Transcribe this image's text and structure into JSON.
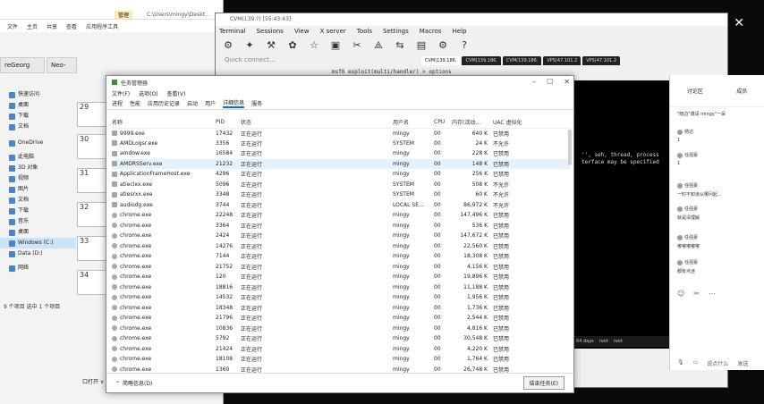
{
  "explorer": {
    "ribbon_tab": "管理",
    "path": "C:\\Users\\mingy\\Deskt...",
    "ribbon": [
      "文件",
      "主页",
      "共享",
      "查看",
      "应用程序工具"
    ],
    "tab1": "reGeorg",
    "tab2": "Neo-",
    "tree": [
      "快速访问",
      "桌面",
      "下载",
      "文档",
      "OneDrive",
      "此电脑",
      "3D 对象",
      "视频",
      "图片",
      "文档",
      "下载",
      "音乐",
      "桌面",
      "Windows (C:)",
      "Data (D:)",
      "网络"
    ],
    "status": "9 个项目  选中 1 个项目",
    "thumb_numbers": [
      "29",
      "30",
      "31",
      "32",
      "33",
      "34"
    ],
    "thumb_footer": "口打开 ∨"
  },
  "moba": {
    "title": "CVM(139.?)  [55:43:43]",
    "menu": [
      "Terminal",
      "Sessions",
      "View",
      "X server",
      "Tools",
      "Settings",
      "Macros",
      "Help"
    ],
    "toolbar": [
      "Session",
      "Servers",
      "Tools",
      "Games",
      "Sessions",
      "View",
      "Split",
      "MultiExec",
      "Tunneling",
      "Packages",
      "Settings",
      "Help"
    ],
    "quick_connect": "Quick connect...",
    "tabs": [
      "CVM(139.186.",
      "CVM(139.186.",
      "CVM(139.186.",
      "VPS(47.101.2",
      "VPS(47.101.2"
    ],
    "cmd": "msf6 exploit(multi/handler) > options",
    "term_lines": [
      "'', seh, thread, process",
      "terface may be specified"
    ],
    "status_items": [
      "64 days",
      "root",
      "root"
    ]
  },
  "chat": {
    "tabs": [
      "讨论区",
      "成员"
    ],
    "messages": [
      "\"暗边\"邀请 mingy\"一朵",
      "杨达",
      "1",
      "任强豪",
      "1",
      "任强豪",
      "一时不知道从哪问起..",
      "任强豪",
      "就是没理解",
      "任强豪",
      "嘟嘟嘟嘟嘟",
      "任强豪",
      "都有点迷"
    ],
    "input_hint": "说点什么",
    "send": "发送"
  },
  "taskmgr": {
    "title": "任务管理器",
    "menu": [
      "文件(F)",
      "选项(O)",
      "查看(V)"
    ],
    "tabs": [
      "进程",
      "性能",
      "应用历史记录",
      "启动",
      "用户",
      "详细信息",
      "服务"
    ],
    "active_tab": "详细信息",
    "columns": [
      "名称",
      "PID",
      "状态",
      "用户名",
      "CPU",
      "内存(活动...",
      "UAC 虚拟化"
    ],
    "rows": [
      [
        "9999.exe",
        "17432",
        "正在运行",
        "mingy",
        "00",
        "640 K",
        "已禁用"
      ],
      [
        "AMDLogsr.exe",
        "3356",
        "正在运行",
        "SYSTEM",
        "00",
        "24 K",
        "不允许"
      ],
      [
        "amdow.exe",
        "16584",
        "正在运行",
        "mingy",
        "00",
        "228 K",
        "已禁用"
      ],
      [
        "AMDRSServ.exe",
        "21232",
        "正在运行",
        "mingy",
        "00",
        "148 K",
        "已禁用"
      ],
      [
        "ApplicationFrameHost.exe",
        "4296",
        "正在运行",
        "mingy",
        "00",
        "256 K",
        "已禁用"
      ],
      [
        "atieclxx.exe",
        "5096",
        "正在运行",
        "SYSTEM",
        "00",
        "508 K",
        "不允许"
      ],
      [
        "atiesrxx.exe",
        "3348",
        "正在运行",
        "SYSTEM",
        "00",
        "60 K",
        "不允许"
      ],
      [
        "audiodg.exe",
        "3744",
        "正在运行",
        "LOCAL SE...",
        "00",
        "86,972 K",
        "不允许"
      ],
      [
        "chrome.exe",
        "22248",
        "正在运行",
        "mingy",
        "00",
        "147,496 K",
        "已禁用"
      ],
      [
        "chrome.exe",
        "3364",
        "正在运行",
        "mingy",
        "00",
        "536 K",
        "已禁用"
      ],
      [
        "chrome.exe",
        "2424",
        "正在运行",
        "mingy",
        "00",
        "147,672 K",
        "已禁用"
      ],
      [
        "chrome.exe",
        "14276",
        "正在运行",
        "mingy",
        "00",
        "22,560 K",
        "已禁用"
      ],
      [
        "chrome.exe",
        "7144",
        "正在运行",
        "mingy",
        "00",
        "18,308 K",
        "已禁用"
      ],
      [
        "chrome.exe",
        "21752",
        "正在运行",
        "mingy",
        "00",
        "4,156 K",
        "已禁用"
      ],
      [
        "chrome.exe",
        "120",
        "正在运行",
        "mingy",
        "00",
        "19,896 K",
        "已禁用"
      ],
      [
        "chrome.exe",
        "18816",
        "正在运行",
        "mingy",
        "00",
        "11,188 K",
        "已禁用"
      ],
      [
        "chrome.exe",
        "14532",
        "正在运行",
        "mingy",
        "00",
        "1,956 K",
        "已禁用"
      ],
      [
        "chrome.exe",
        "18348",
        "正在运行",
        "mingy",
        "00",
        "1,736 K",
        "已禁用"
      ],
      [
        "chrome.exe",
        "21796",
        "正在运行",
        "mingy",
        "00",
        "2,544 K",
        "已禁用"
      ],
      [
        "chrome.exe",
        "10836",
        "正在运行",
        "mingy",
        "00",
        "4,816 K",
        "已禁用"
      ],
      [
        "chrome.exe",
        "5792",
        "正在运行",
        "mingy",
        "00",
        "30,548 K",
        "已禁用"
      ],
      [
        "chrome.exe",
        "21424",
        "正在运行",
        "mingy",
        "00",
        "4,220 K",
        "已禁用"
      ],
      [
        "chrome.exe",
        "18108",
        "正在运行",
        "mingy",
        "00",
        "1,764 K",
        "已禁用"
      ],
      [
        "chrome.exe",
        "1360",
        "正在运行",
        "mingy",
        "00",
        "26,748 K",
        "已禁用"
      ]
    ],
    "highlight_row": 3,
    "footer_less": "简略信息(D)",
    "footer_end": "结束任务(E)"
  }
}
